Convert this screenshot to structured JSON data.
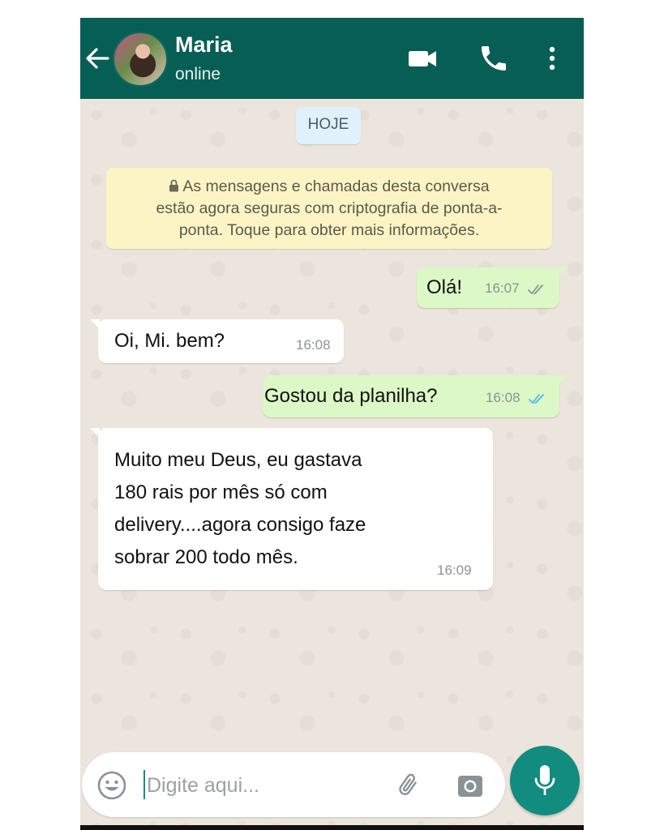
{
  "header": {
    "contact_name": "Maria",
    "contact_status": "online",
    "back_icon": "arrow-left-icon",
    "video_icon": "video-camera-icon",
    "call_icon": "phone-icon",
    "menu_icon": "more-vertical-icon",
    "color": "#075e54"
  },
  "chat": {
    "date_chip": "HOJE",
    "encryption_notice": {
      "line1": "As mensagens e chamadas desta conversa",
      "line2": "estão agora seguras com criptografia de ponta-a-",
      "line3": "ponta. Toque para obter mais informações."
    },
    "messages": [
      {
        "direction": "outgoing",
        "text": "Olá!",
        "time": "16:07",
        "status": "delivered"
      },
      {
        "direction": "incoming",
        "text": "Oi, Mi. bem?",
        "time": "16:08"
      },
      {
        "direction": "outgoing",
        "text": "Gostou da planilha?",
        "time": "16:08",
        "status": "read"
      },
      {
        "direction": "incoming",
        "text": "Muito meu Deus, eu gastava\n180 rais por mês só com\ndelivery....agora consigo faze\nsobrar 200 todo mês.",
        "time": "16:09"
      }
    ]
  },
  "composer": {
    "placeholder": "Digite aqui...",
    "emoji_icon": "emoji-icon",
    "attach_icon": "paperclip-icon",
    "camera_icon": "camera-icon",
    "mic_icon": "microphone-icon",
    "accent": "#128c7e"
  },
  "colors": {
    "outgoing_bubble": "#dcf8c6",
    "incoming_bubble": "#ffffff",
    "wallpaper": "#ece5dd",
    "read_ticks": "#4fb6ec"
  }
}
